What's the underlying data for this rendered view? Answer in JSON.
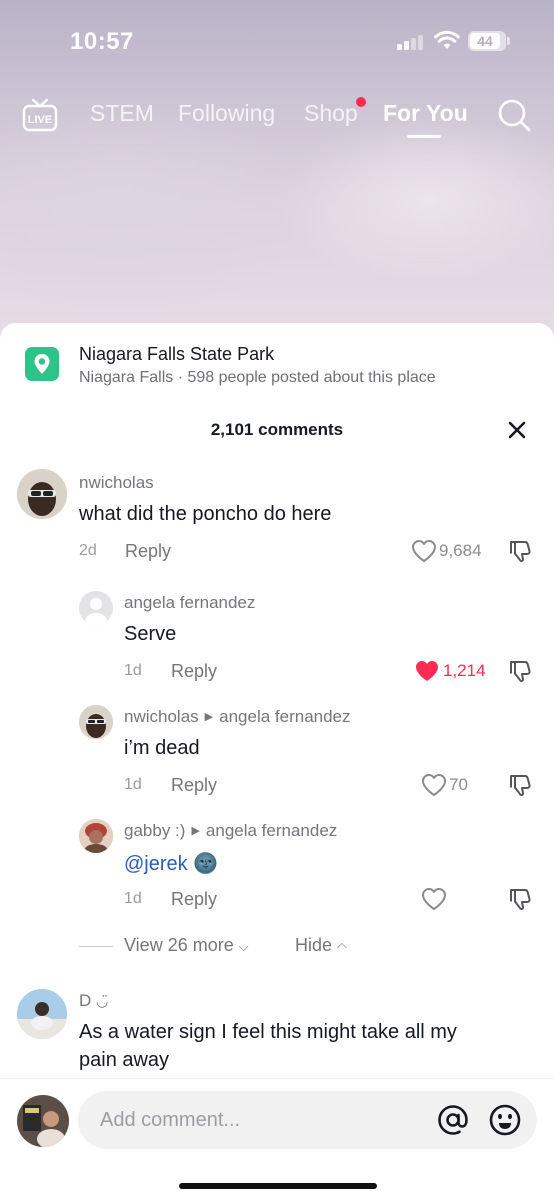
{
  "status_bar": {
    "time": "10:57",
    "battery": "44"
  },
  "top_nav": {
    "tabs": [
      {
        "label": "STEM"
      },
      {
        "label": "Following"
      },
      {
        "label": "Shop"
      },
      {
        "label": "For You",
        "active": true
      }
    ],
    "live_label": "LIVE",
    "shop_badge_color": "#ff2b55"
  },
  "place": {
    "title": "Niagara Falls State Park",
    "subtitle": "Niagara Falls · 598 people posted about this place",
    "icon": "location-pin-icon",
    "icon_color": "#2ec489"
  },
  "comments_header": {
    "count_label": "2,101 comments"
  },
  "comments": [
    {
      "user": "nwicholas",
      "text": "what did the poncho do here",
      "age": "2d",
      "reply_label": "Reply",
      "likes": "9,684",
      "liked": false
    },
    {
      "user": "angela fernandez",
      "text": "Serve",
      "age": "1d",
      "reply_label": "Reply",
      "likes": "1,214",
      "liked": true
    },
    {
      "user": "nwicholas",
      "reply_to": "angela fernandez",
      "text": "i’m dead",
      "age": "1d",
      "reply_label": "Reply",
      "likes": "70",
      "liked": false
    },
    {
      "user": "gabby :)",
      "reply_to": "angela fernandez",
      "text": "@jerek",
      "emoji": "🌚",
      "age": "1d",
      "reply_label": "Reply",
      "likes": "",
      "liked": false
    },
    {
      "user": "D",
      "user_suffix": "◡̈",
      "text_line1": "As a water sign I feel this might take all my",
      "text_line2": "pain away"
    }
  ],
  "thread_controls": {
    "view_more_label": "View 26 more",
    "hide_label": "Hide"
  },
  "composer": {
    "placeholder": "Add comment..."
  },
  "colors": {
    "like_active": "#fe2c55",
    "mention": "#2b5db9"
  }
}
